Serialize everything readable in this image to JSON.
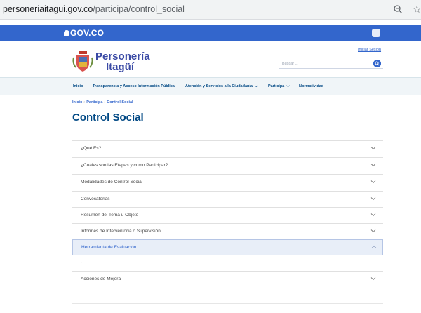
{
  "browser": {
    "url_domain": "personeriaitagui.gov.co",
    "url_path": "/participa/control_social",
    "zoom_icon": "magnifier-zoom-icon",
    "star_icon": "bookmark-star-icon",
    "star_glyph": "☆"
  },
  "govbar": {
    "logo_text": "GOV.CO",
    "color": "#3366cc"
  },
  "header": {
    "logo_line1": "Personería",
    "logo_line2": "Itagüí",
    "login_link": "Iniciar Sesión",
    "search_placeholder": "Buscar ..."
  },
  "nav": {
    "items": [
      {
        "label": "Inicio",
        "has_dropdown": false
      },
      {
        "label": "Transparencia y Acceso Información Pública",
        "has_dropdown": false
      },
      {
        "label": "Atención y Servicios a la Ciudadanía",
        "has_dropdown": true
      },
      {
        "label": "Participa",
        "has_dropdown": true
      },
      {
        "label": "Normatividad",
        "has_dropdown": false
      }
    ]
  },
  "breadcrumb": {
    "items": [
      "Inicio",
      "Participa",
      "Control Social"
    ],
    "separator": "›"
  },
  "page": {
    "title": "Control Social"
  },
  "accordion": {
    "items": [
      {
        "label": "¿Qué Es?",
        "expanded": false
      },
      {
        "label": "¿Cuáles son las Etapas y como Participar?",
        "expanded": false
      },
      {
        "label": "Modalidades de Control Social",
        "expanded": false
      },
      {
        "label": "Convocatorias",
        "expanded": false
      },
      {
        "label": "Resumen del Tema u Objeto",
        "expanded": false
      },
      {
        "label": "Informes de Interventoría o Supervisión",
        "expanded": false
      },
      {
        "label": "Herramienta de Evaluación",
        "expanded": true
      },
      {
        "label": "Acciones de Mejora",
        "expanded": false
      }
    ],
    "open_body_text": "·"
  }
}
